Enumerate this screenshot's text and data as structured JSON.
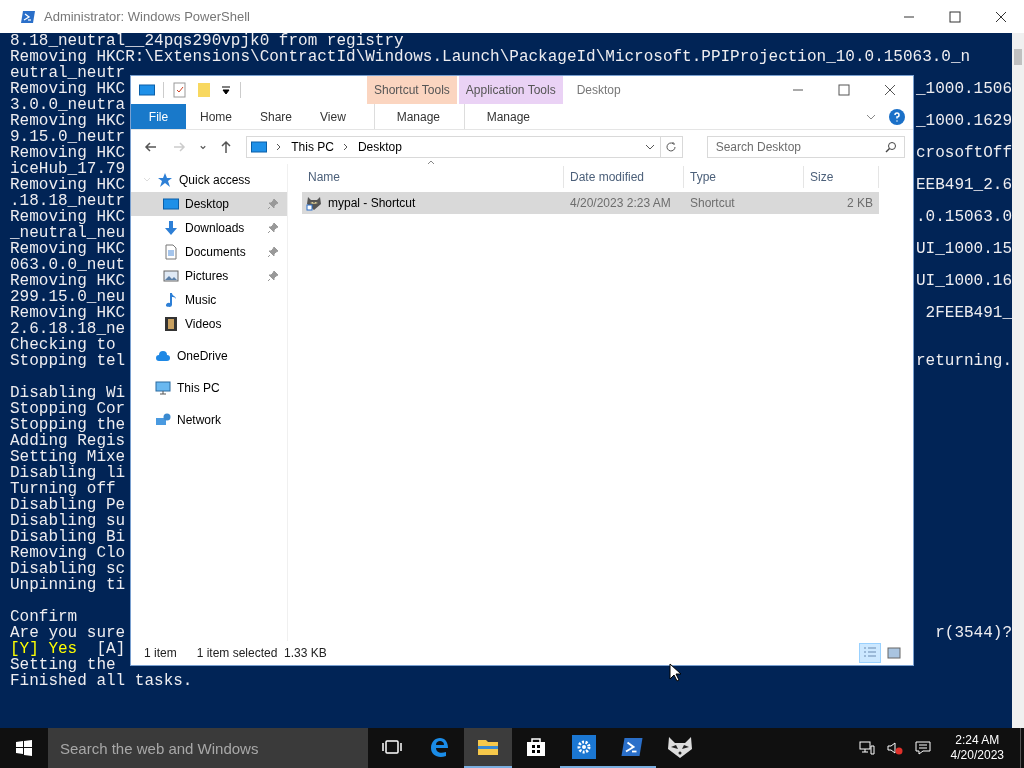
{
  "powershell": {
    "title": "Administrator: Windows PowerShell",
    "lines": [
      {
        "text": "8.18_neutral__24pqs290vpjk0 from registry"
      },
      {
        "text": "Removing HKCR:\\Extensions\\ContractId\\Windows.Launch\\PackageId\\Microsoft.PPIProjection_10.0.15063.0_n"
      },
      {
        "text": "eutral_neutr"
      },
      {
        "text": "Removing HKC",
        "right": "_1000.1506"
      },
      {
        "text": "3.0.0_neutra"
      },
      {
        "text": "Removing HKC",
        "right": "_1000.1629"
      },
      {
        "text": "9.15.0_neutr"
      },
      {
        "text": "Removing HKC",
        "right": "crosoftOff"
      },
      {
        "text": "iceHub_17.79"
      },
      {
        "text": "Removing HKC",
        "right": "EEB491_2.6"
      },
      {
        "text": ".18.18_neutr"
      },
      {
        "text": "Removing HKC",
        "right": ".0.15063.0"
      },
      {
        "text": "_neutral_neu"
      },
      {
        "text": "Removing HKC",
        "right": "UI_1000.15"
      },
      {
        "text": "063.0.0_neut"
      },
      {
        "text": "Removing HKC",
        "right": "UI_1000.16"
      },
      {
        "text": "299.15.0_neu"
      },
      {
        "text": "Removing HKC",
        "right": "2FEEB491_"
      },
      {
        "text": "2.6.18.18_ne"
      },
      {
        "text": "Checking to"
      },
      {
        "text": "Stopping tel",
        "right": "returning."
      },
      {
        "text": "Disabling Wi",
        "gap_before": true
      },
      {
        "text": "Stopping Cor"
      },
      {
        "text": "Stopping the"
      },
      {
        "text": "Adding Regis"
      },
      {
        "text": "Setting Mixe"
      },
      {
        "text": "Disabling li"
      },
      {
        "text": "Turning off"
      },
      {
        "text": "Disabling Pe"
      },
      {
        "text": "Disabling su"
      },
      {
        "text": "Disabling Bi"
      },
      {
        "text": "Removing Clo"
      },
      {
        "text": "Disabling sc"
      },
      {
        "text": "Unpinning ti"
      },
      {
        "text": "Confirm",
        "gap_before": true
      },
      {
        "text": "Are you sure",
        "right": "r(3544)?"
      },
      {
        "accent": "[Y] Yes",
        "text": "  [A]"
      },
      {
        "text": "Setting the"
      },
      {
        "text": "Finished all tasks."
      }
    ]
  },
  "explorer": {
    "title": "Desktop",
    "context_groups": [
      {
        "label": "Shortcut Tools",
        "tab": "Manage",
        "color": "#fbd5c0"
      },
      {
        "label": "Application Tools",
        "tab": "Manage",
        "color": "#ead2f5"
      }
    ],
    "tabs": [
      {
        "label": "File",
        "kind": "file",
        "selected": false
      },
      {
        "label": "Home",
        "kind": "tab",
        "selected": false
      },
      {
        "label": "Share",
        "kind": "tab",
        "selected": false
      },
      {
        "label": "View",
        "kind": "tab",
        "selected": false
      }
    ],
    "nav": [
      {
        "kind": "back",
        "disabled": false
      },
      {
        "kind": "forward",
        "disabled": true
      },
      {
        "kind": "recent",
        "disabled": false
      },
      {
        "kind": "up",
        "disabled": false
      }
    ],
    "breadcrumb": [
      "This PC",
      "Desktop"
    ],
    "search": {
      "placeholder": "Search Desktop"
    },
    "tree": [
      {
        "label": "Quick access",
        "kind": "star",
        "selected": false,
        "expanded": true,
        "children": [
          {
            "label": "Desktop",
            "kind": "desktop",
            "selected": true,
            "pinned": true
          },
          {
            "label": "Downloads",
            "kind": "download",
            "selected": false,
            "pinned": true
          },
          {
            "label": "Documents",
            "kind": "document",
            "selected": false,
            "pinned": true
          },
          {
            "label": "Pictures",
            "kind": "picture",
            "selected": false,
            "pinned": true
          },
          {
            "label": "Music",
            "kind": "music",
            "selected": false,
            "pinned": false
          },
          {
            "label": "Videos",
            "kind": "video",
            "selected": false,
            "pinned": false
          }
        ]
      },
      {
        "label": "OneDrive",
        "kind": "cloud",
        "selected": false
      },
      {
        "label": "This PC",
        "kind": "pc",
        "selected": false
      },
      {
        "label": "Network",
        "kind": "network",
        "selected": false
      }
    ],
    "columns": [
      "Name",
      "Date modified",
      "Type",
      "Size"
    ],
    "rows": [
      {
        "name": "mypal - Shortcut",
        "date": "4/20/2023 2:23 AM",
        "type": "Shortcut",
        "size": "2 KB",
        "selected": true
      }
    ],
    "status": {
      "count": "1 item",
      "selection": "1 item selected  1.33 KB"
    },
    "views": [
      {
        "kind": "details",
        "selected": true
      },
      {
        "kind": "large-icons",
        "selected": false
      }
    ]
  },
  "taskbar": {
    "search": {
      "placeholder": "Search the web and Windows"
    },
    "apps": [
      {
        "kind": "task-view",
        "active": false,
        "selected": false
      },
      {
        "kind": "edge",
        "active": false,
        "selected": false
      },
      {
        "kind": "explorer",
        "active": true,
        "selected": true
      },
      {
        "kind": "store",
        "active": false,
        "selected": false
      },
      {
        "kind": "settings",
        "active": true,
        "selected": false
      },
      {
        "kind": "powershell",
        "active": true,
        "selected": false
      },
      {
        "kind": "mypal",
        "active": false,
        "selected": false
      }
    ],
    "time": "2:24 AM",
    "date": "4/20/2023",
    "muted": true
  }
}
